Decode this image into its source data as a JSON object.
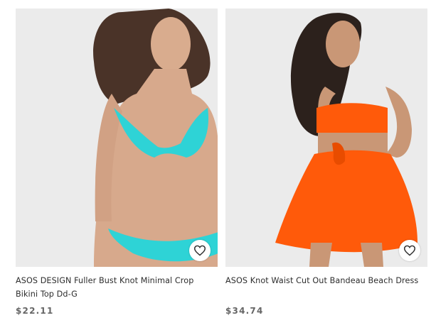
{
  "products": [
    {
      "title": "ASOS DESIGN Fuller Bust Knot Minimal Crop Bikini Top Dd-G",
      "price": "$22.11",
      "save_icon": "heart-outline-icon",
      "image_alt": "Model wearing turquoise knot bikini"
    },
    {
      "title": "ASOS Knot Waist Cut Out Bandeau Beach Dress",
      "price": "$34.74",
      "save_icon": "heart-outline-icon",
      "image_alt": "Model wearing orange bandeau beach dress"
    }
  ],
  "colors": {
    "image_bg": "#ececec",
    "bikini": "#2ed3d6",
    "dress": "#ff5a0a",
    "skin": "#d7a98c",
    "hair": "#4a3328"
  }
}
